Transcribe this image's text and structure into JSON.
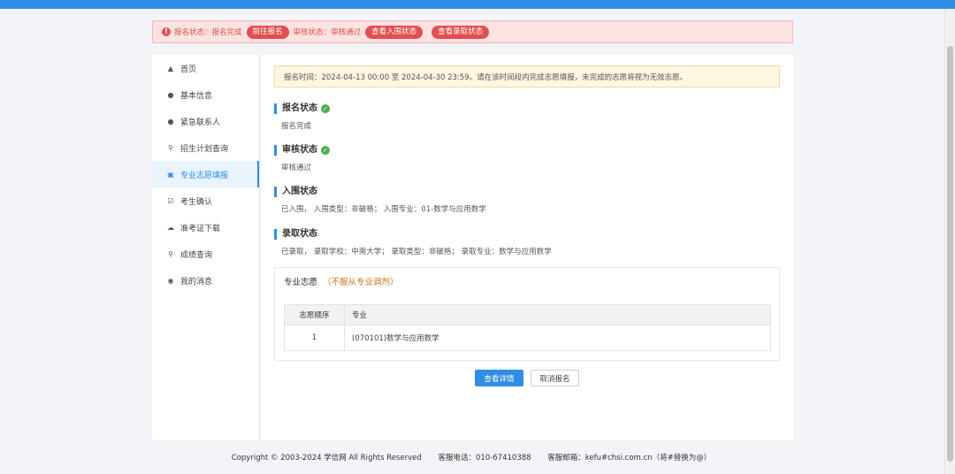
{
  "alert": {
    "reg_status_label": "报名状态：",
    "reg_status_value": "报名完成",
    "go_register_button": "前往报名",
    "review_status_label": "审核状态：",
    "review_status_value": "审核通过",
    "view_shortlist_button": "查看入围状态",
    "view_admission_button": "查看录取状态"
  },
  "sidebar": {
    "items": [
      {
        "label": "首页",
        "icon": "home-icon"
      },
      {
        "label": "基本信息",
        "icon": "user-icon"
      },
      {
        "label": "紧急联系人",
        "icon": "user-icon"
      },
      {
        "label": "招生计划查询",
        "icon": "search-icon"
      },
      {
        "label": "专业志愿填报",
        "icon": "form-icon"
      },
      {
        "label": "考生确认",
        "icon": "checkbox-icon"
      },
      {
        "label": "准考证下载",
        "icon": "cloud-download-icon"
      },
      {
        "label": "成绩查询",
        "icon": "search-icon"
      },
      {
        "label": "我的消息",
        "icon": "bell-icon"
      }
    ],
    "active_index": 4
  },
  "notice": "报名时间：2024-04-13 00:00 至 2024-04-30 23:59。请在该时间段内完成志愿填报，未完成的志愿将视为无效志愿。",
  "sections": {
    "registration": {
      "title": "报名状态",
      "value": "报名完成"
    },
    "review": {
      "title": "审核状态",
      "value": "审核通过"
    },
    "shortlist": {
      "title": "入围状态",
      "value": "已入围， 入围类型：非破格； 入围专业：01-数学与应用数学"
    },
    "admission": {
      "title": "录取状态",
      "value": "已录取， 录取学校：中南大学； 录取类型：非破格； 录取专业：数学与应用数学"
    }
  },
  "preferences": {
    "title": "专业志愿",
    "note": "（不服从专业调剂）",
    "columns": [
      "志愿顺序",
      "专业"
    ],
    "rows": [
      {
        "order": "1",
        "major": "(070101)数学与应用数学"
      }
    ]
  },
  "buttons": {
    "view_details": "查看详情",
    "cancel_registration": "取消报名"
  },
  "footer": {
    "copyright": "Copyright © 2003-2024 学信网 All Rights Reserved",
    "phone": "客服电话：010-67410388",
    "email": "客服邮箱：kefu#chsi.com.cn（将#替换为@）"
  },
  "colors": {
    "primary": "#2f8de4",
    "alert_red": "#e24f4f",
    "success": "#4caf50",
    "warning_note": "#c8731a"
  }
}
